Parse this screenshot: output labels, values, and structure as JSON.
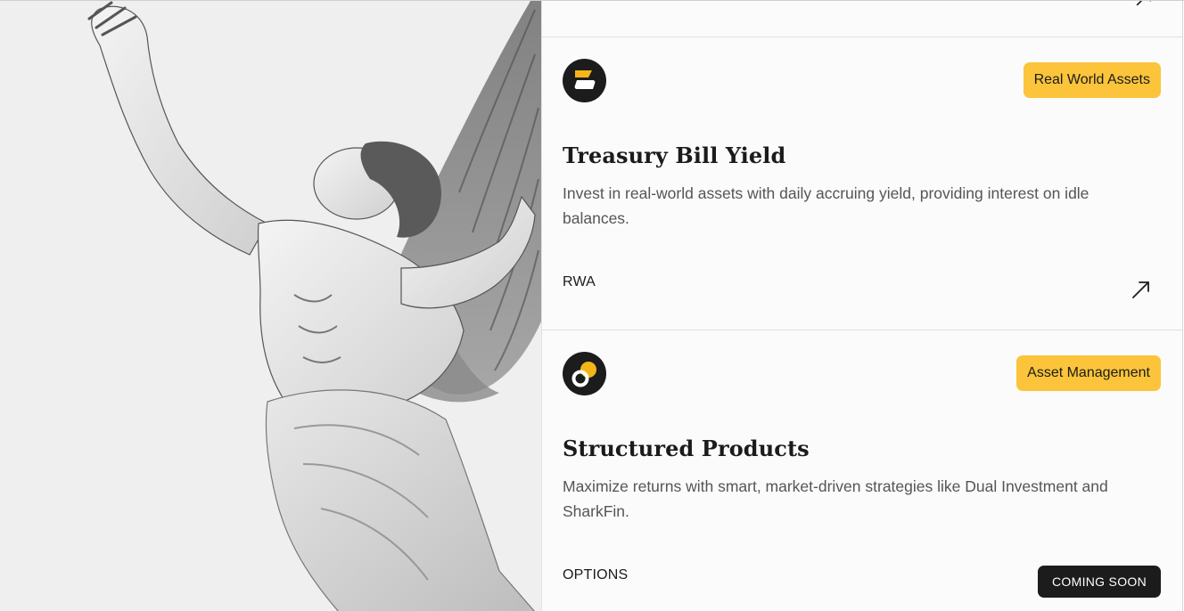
{
  "illustration": {
    "icon": "winged-figure-illustration"
  },
  "products": [
    {
      "logo_icon": "layers-logo-icon",
      "tag": "Real World Assets",
      "title": "Treasury Bill Yield",
      "description": "Invest in real-world assets with daily accruing yield, providing interest on idle balances.",
      "category": "RWA",
      "action_icon": "arrow-up-right-icon"
    },
    {
      "logo_icon": "rings-logo-icon",
      "tag": "Asset Management",
      "title": "Structured Products",
      "description": "Maximize returns with smart, market-driven strategies like Dual Investment and SharkFin.",
      "category": "OPTIONS",
      "status": "COMING SOON"
    }
  ],
  "colors": {
    "accent": "#fbc43a",
    "dark": "#1c1c1c",
    "text_muted": "#555555",
    "panel_bg": "#fbfbfb",
    "art_bg": "#efefef"
  }
}
